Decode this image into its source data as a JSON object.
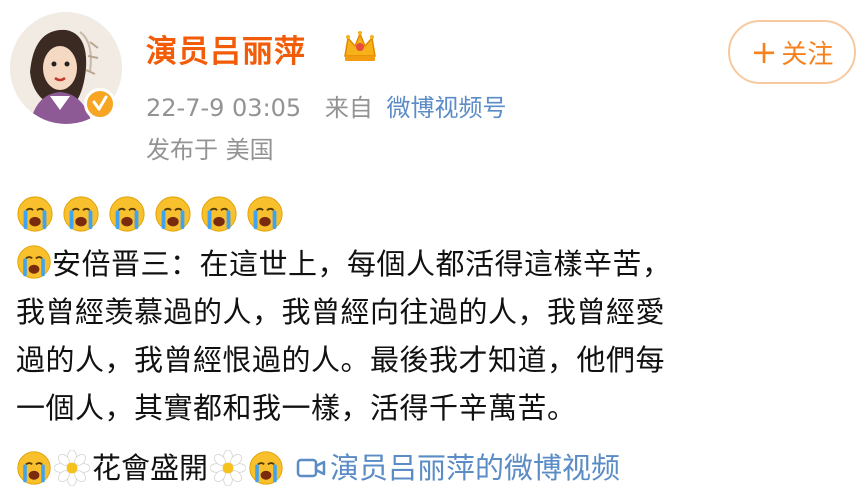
{
  "user": {
    "name": "演员吕丽萍",
    "timestamp": "22-7-9 03:05",
    "source_prefix": "来自",
    "source": "微博视频号",
    "location": "发布于 美国"
  },
  "follow_button": {
    "label": "关注",
    "icon": "plus-icon"
  },
  "post": {
    "lines": [
      "安倍晋三：在這世上，每個人都活得這樣辛苦，",
      "我曾經羡慕過的人，我曾經向往過的人，我曾經愛",
      "過的人，我曾經恨過的人。最後我才知道，他們每",
      "一個人，其實都和我一樣，活得千辛萬苦。"
    ],
    "tag_text": "花會盛開",
    "video_link": "演员吕丽萍的微博视频"
  },
  "icons": {
    "cry": "crying-face-emoji",
    "flower": "white-flower-emoji",
    "crown": "crown-badge-icon",
    "verified": "verified-badge-icon",
    "video": "video-link-icon"
  },
  "colors": {
    "username": "#f25b07",
    "link": "#5b8cc6",
    "meta": "#939393",
    "follow": "#f5821f"
  }
}
